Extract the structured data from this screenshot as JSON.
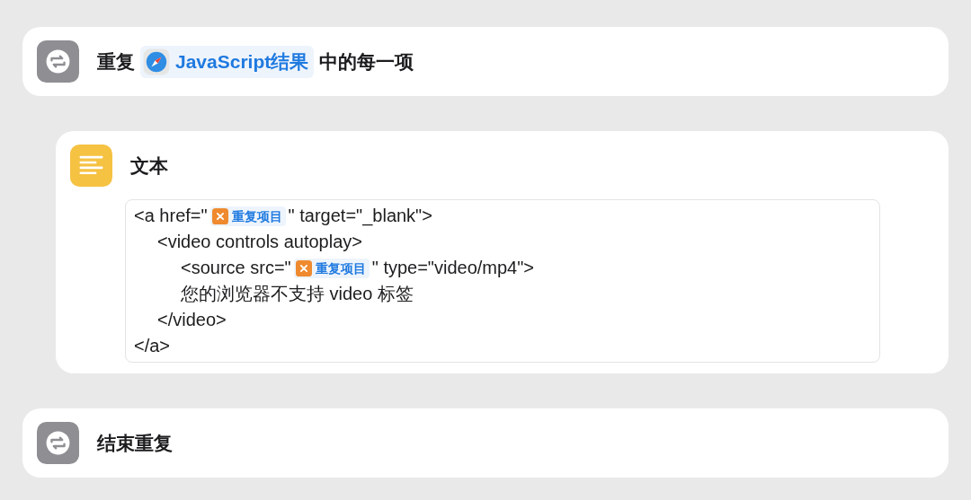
{
  "actions": [
    {
      "kind": "repeat",
      "title": [
        {
          "kind": "text",
          "text": "重复"
        },
        {
          "kind": "app-variable",
          "text": "JavaScript结果"
        },
        {
          "kind": "text",
          "text": "中的每一项"
        }
      ]
    },
    {
      "kind": "text",
      "title": [
        {
          "kind": "text",
          "text": "文本"
        }
      ],
      "content": [
        {
          "segments": [
            {
              "kind": "text",
              "text": "<a href=\""
            },
            {
              "kind": "variable",
              "text": "重复项目"
            },
            {
              "kind": "text",
              "text": "\" target=\"_blank\">"
            }
          ],
          "children": [
            {
              "segments": [
                {
                  "kind": "text",
                  "text": "<video controls autoplay>"
                }
              ],
              "children": [
                {
                  "segments": [
                    {
                      "kind": "text",
                      "text": "<source src=\""
                    },
                    {
                      "kind": "variable",
                      "text": "重复项目"
                    },
                    {
                      "kind": "text",
                      "text": "\" type=\"video/mp4\">"
                    }
                  ]
                },
                {
                  "segments": [
                    {
                      "kind": "text",
                      "text": "您的浏览器不支持 video 标签"
                    }
                  ]
                }
              ]
            },
            {
              "segments": [
                {
                  "kind": "text",
                  "text": "</video>"
                }
              ]
            }
          ]
        },
        {
          "segments": [
            {
              "kind": "text",
              "text": "</a>"
            }
          ]
        }
      ]
    },
    {
      "kind": "end-repeat",
      "title": [
        {
          "kind": "text",
          "text": "结束重复"
        }
      ]
    }
  ]
}
